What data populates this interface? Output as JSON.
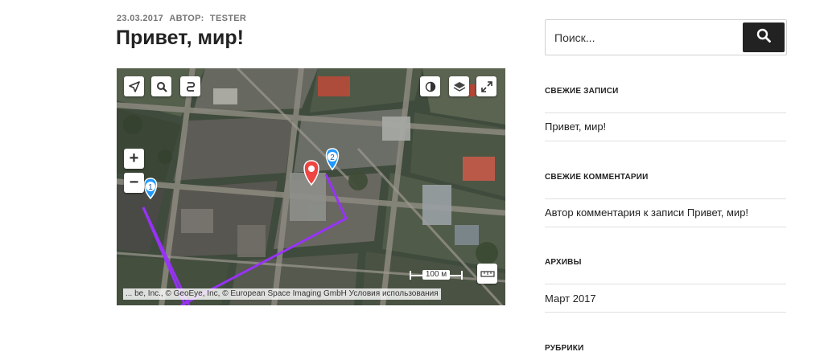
{
  "post": {
    "date": "23.03.2017",
    "author_label": "АВТОР:",
    "author": "TESTER",
    "title": "Привет, мир!"
  },
  "map": {
    "controls": {
      "geolocation_icon": "location-arrow-icon",
      "search_icon": "search-icon",
      "route_icon": "route-icon",
      "traffic_icon": "traffic-icon",
      "layers_icon": "layers-icon",
      "fullscreen_icon": "fullscreen-icon",
      "zoom_in": "+",
      "zoom_out": "−",
      "ruler_icon": "ruler-icon"
    },
    "markers": [
      {
        "label": "1",
        "color": "#1e98ff"
      },
      {
        "label": "2",
        "color": "#1e98ff"
      }
    ],
    "main_marker_color": "#ed4543",
    "route_color": "#9b30ff",
    "scale_label": "100 м",
    "copyright": "... be, Inc., © GeoEye, Inc, © European Space Imaging GmbH",
    "terms_link": "Условия использования"
  },
  "sidebar": {
    "search": {
      "placeholder": "Поиск...",
      "button_icon": "search-icon"
    },
    "recent_posts": {
      "title": "СВЕЖИЕ ЗАПИСИ",
      "items": [
        "Привет, мир!"
      ]
    },
    "recent_comments": {
      "title": "СВЕЖИЕ КОММЕНТАРИИ",
      "items": [
        "Автор комментария к записи Привет, мир!"
      ]
    },
    "archives": {
      "title": "АРХИВЫ",
      "items": [
        "Март 2017"
      ]
    },
    "categories": {
      "title": "РУБРИКИ"
    }
  }
}
